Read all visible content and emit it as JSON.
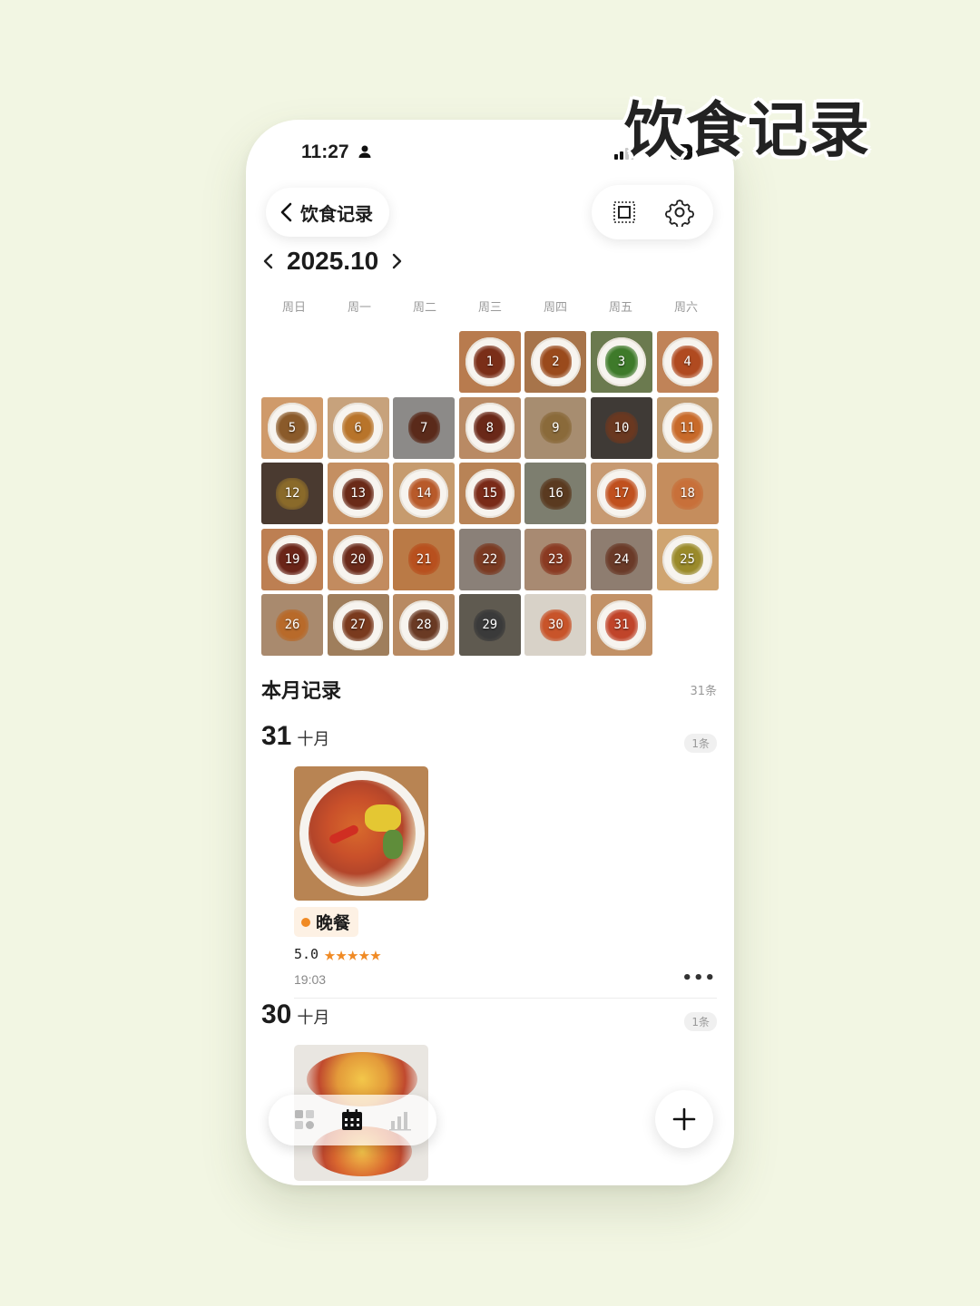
{
  "hero_title": "饮食记录",
  "status": {
    "time": "11:27",
    "battery": "99"
  },
  "header": {
    "back_label": "饮食记录"
  },
  "calendar": {
    "month": "2025.10",
    "weekdays": [
      "周日",
      "周一",
      "周二",
      "周三",
      "周四",
      "周五",
      "周六"
    ],
    "days": [
      "1",
      "2",
      "3",
      "4",
      "5",
      "6",
      "7",
      "8",
      "9",
      "10",
      "11",
      "12",
      "13",
      "14",
      "15",
      "16",
      "17",
      "18",
      "19",
      "20",
      "21",
      "22",
      "23",
      "24",
      "25",
      "26",
      "27",
      "28",
      "29",
      "30",
      "31"
    ]
  },
  "records": {
    "title": "本月记录",
    "count": "31条",
    "days": [
      {
        "day": "31",
        "month": "十月",
        "badge": "1条",
        "meal": "晚餐",
        "score": "5.0",
        "stars": "★★★★★",
        "time": "19:03"
      },
      {
        "day": "30",
        "month": "十月",
        "badge": "1条"
      }
    ]
  },
  "colors": {
    "accent": "#f08a24",
    "background": "#f2f6e3"
  },
  "icons": [
    "person-icon",
    "signal-icon",
    "wifi-icon",
    "chevron-left-icon",
    "chevron-right-icon",
    "crop-icon",
    "gear-icon",
    "grid-icon",
    "calendar-icon",
    "bar-chart-icon",
    "plus-icon",
    "more-icon"
  ]
}
